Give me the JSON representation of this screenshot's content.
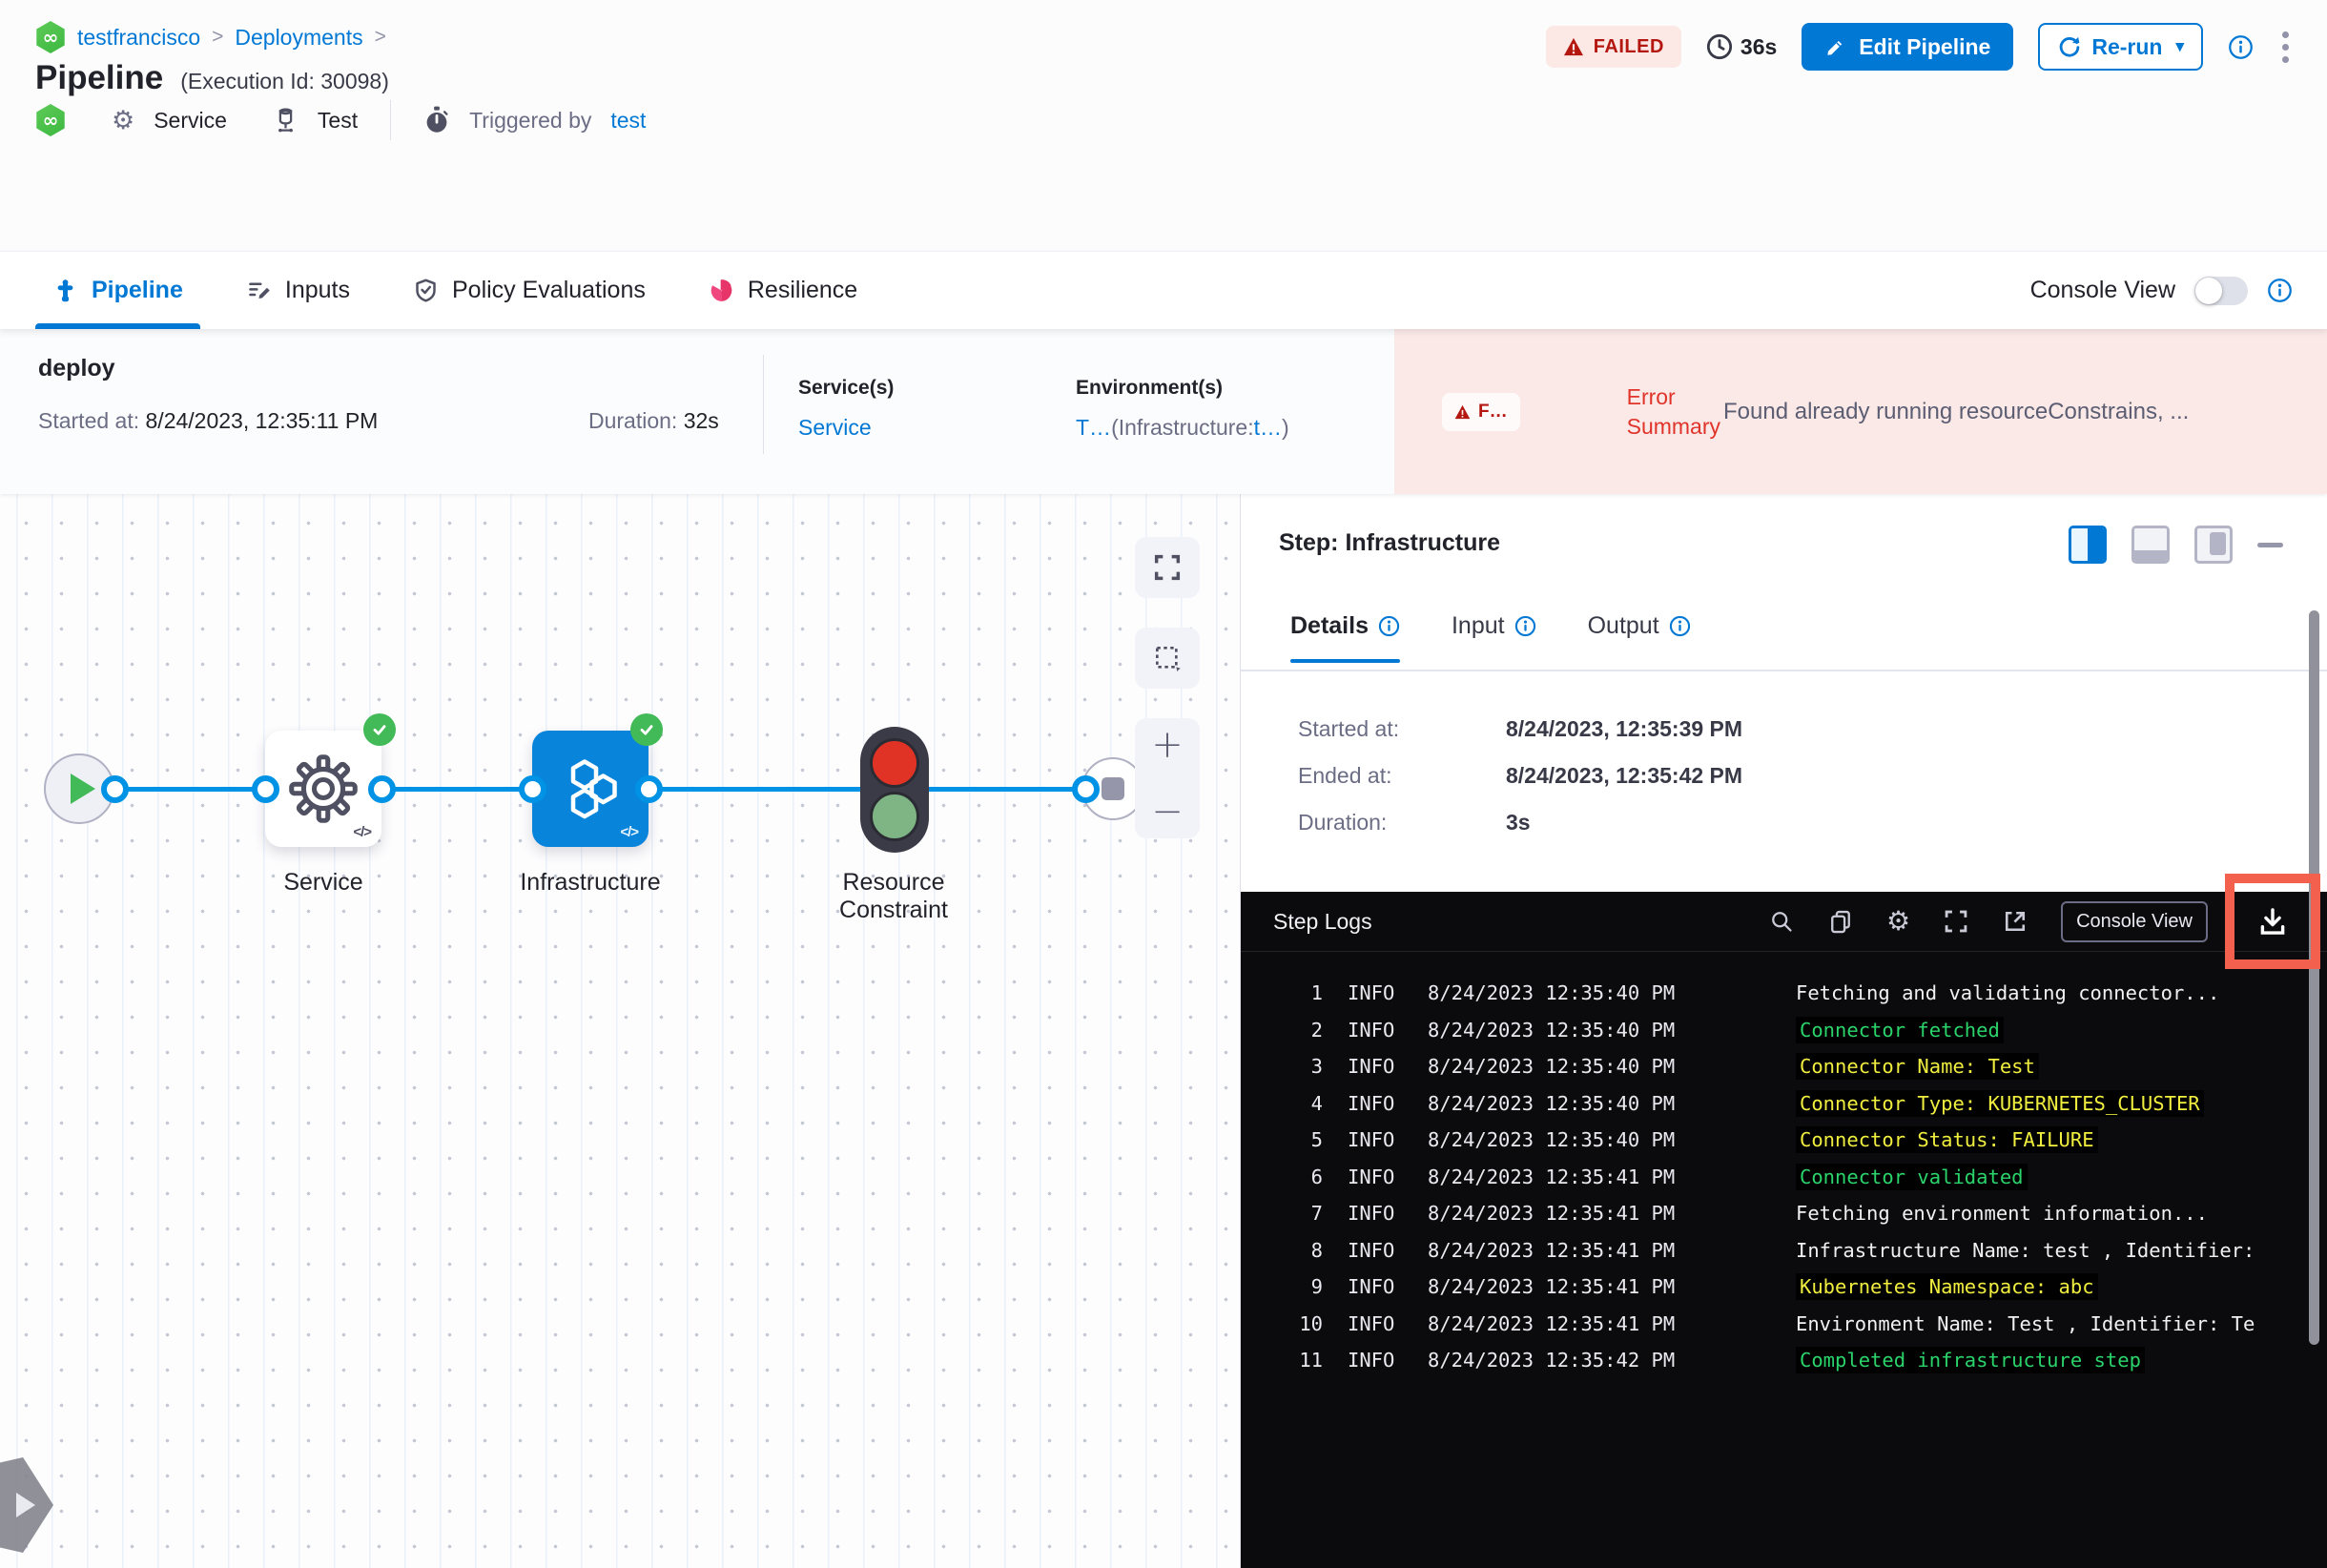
{
  "colors": {
    "accent_blue": "#0278d5",
    "edge_blue": "#0092e4",
    "node_blue": "#0884da",
    "success_green": "#42ba57",
    "failed_red": "#b41710",
    "failed_bg": "#fce9e6",
    "error_bg": "#fbe9e7",
    "error_red": "#e0342b",
    "log_green": "#2bd46b",
    "log_yellow": "#f0ee3f",
    "highlight_red": "#f4604e",
    "console_bg": "#0b0b0e"
  },
  "icons": {
    "infinity": "∞",
    "gear": "⚙",
    "caret_down": "▾"
  },
  "breadcrumb": {
    "project": "testfrancisco",
    "separator": ">",
    "section": "Deployments"
  },
  "header": {
    "title": "Pipeline",
    "execution_id": "(Execution Id: 30098)",
    "status_badge": "FAILED",
    "elapsed": "36s",
    "edit_pipeline": "Edit Pipeline",
    "rerun": "Re-run",
    "service": "Service",
    "test": "Test",
    "triggered_by": "Triggered by",
    "triggered_by_user": "test"
  },
  "tabs": {
    "pipeline": "Pipeline",
    "inputs": "Inputs",
    "policy": "Policy Evaluations",
    "resilience": "Resilience",
    "console_view": "Console View"
  },
  "stage": {
    "name": "deploy",
    "started_label": "Started at: ",
    "started_value": "8/24/2023, 12:35:11 PM",
    "duration_label": "Duration: ",
    "duration_value": "32s",
    "services_label": "Service(s)",
    "service_link": "Service",
    "environments_label": "Environment(s)",
    "env_t": "T…",
    "env_infra": "(Infrastructure:",
    "env_t2": "t…",
    "env_close": ")",
    "error_badge": "F…",
    "error_line1": "Error",
    "error_line2": "Summary",
    "error_message": "Found already running resourceConstrains, ..."
  },
  "graph": {
    "service_label": "Service",
    "infrastructure_label": "Infrastructure",
    "resource_constraint_label": "Resource Constraint",
    "code_glyph": "</>",
    "zoom_plus": "+",
    "zoom_minus": "−"
  },
  "step_panel": {
    "title": "Step: Infrastructure",
    "tab_details": "Details",
    "tab_input": "Input",
    "tab_output": "Output",
    "started_label": "Started at:",
    "started_value": "8/24/2023, 12:35:39 PM",
    "ended_label": "Ended at:",
    "ended_value": "8/24/2023, 12:35:42 PM",
    "duration_label": "Duration:",
    "duration_value": "3s"
  },
  "logs": {
    "title": "Step Logs",
    "console_view_button": "Console View",
    "lines": [
      {
        "n": "1",
        "level": "INFO",
        "time": "8/24/2023 12:35:40 PM",
        "msg": "Fetching and validating connector...",
        "color": "white"
      },
      {
        "n": "2",
        "level": "INFO",
        "time": "8/24/2023 12:35:40 PM",
        "msg": "Connector fetched",
        "color": "green"
      },
      {
        "n": "3",
        "level": "INFO",
        "time": "8/24/2023 12:35:40 PM",
        "msg": "Connector Name: Test",
        "color": "yellow"
      },
      {
        "n": "4",
        "level": "INFO",
        "time": "8/24/2023 12:35:40 PM",
        "msg": "Connector Type: KUBERNETES_CLUSTER",
        "color": "yellow"
      },
      {
        "n": "5",
        "level": "INFO",
        "time": "8/24/2023 12:35:40 PM",
        "msg": "Connector Status: FAILURE",
        "color": "yellow"
      },
      {
        "n": "6",
        "level": "INFO",
        "time": "8/24/2023 12:35:41 PM",
        "msg": "Connector validated",
        "color": "green"
      },
      {
        "n": "7",
        "level": "INFO",
        "time": "8/24/2023 12:35:41 PM",
        "msg": "Fetching environment information...",
        "color": "white"
      },
      {
        "n": "8",
        "level": "INFO",
        "time": "8/24/2023 12:35:41 PM",
        "msg": "Infrastructure Name: test , Identifier:",
        "color": "white"
      },
      {
        "n": "9",
        "level": "INFO",
        "time": "8/24/2023 12:35:41 PM",
        "msg": "Kubernetes Namespace: abc",
        "color": "yellow"
      },
      {
        "n": "10",
        "level": "INFO",
        "time": "8/24/2023 12:35:41 PM",
        "msg": "Environment Name: Test , Identifier: Te",
        "color": "white"
      },
      {
        "n": "11",
        "level": "INFO",
        "time": "8/24/2023 12:35:42 PM",
        "msg": "Completed infrastructure step",
        "color": "green"
      }
    ]
  }
}
